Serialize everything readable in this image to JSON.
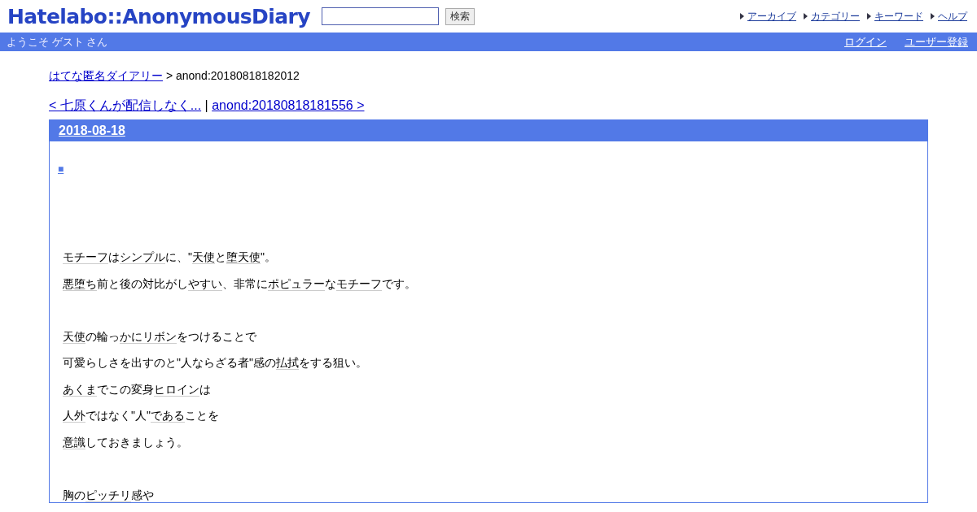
{
  "header": {
    "logo": "Hatelabo::AnonymousDiary",
    "search": {
      "button": "検索"
    },
    "nav": [
      "アーカイブ",
      "カテゴリー",
      "キーワード",
      "ヘルプ"
    ]
  },
  "userbar": {
    "welcome": "ようこそ ゲスト さん",
    "links": [
      "ログイン",
      "ユーザー登録"
    ]
  },
  "breadcrumb": {
    "home": "はてな匿名ダイアリー",
    "separator": ">",
    "current": "anond:20180818182012"
  },
  "pager": {
    "prev": "< 七原くんが配信しなく...",
    "separator": "|",
    "next": "anond:20180818181556 >"
  },
  "day": {
    "date": "2018-08-18",
    "section_mark": "■",
    "lines": [
      {
        "kind": "text",
        "segments": [
          {
            "text": "モチーフ",
            "keyword": true
          },
          {
            "text": "は",
            "keyword": false
          },
          {
            "text": "シンプル",
            "keyword": true
          },
          {
            "text": "に、\"",
            "keyword": false
          },
          {
            "text": "天使",
            "keyword": true
          },
          {
            "text": "と",
            "keyword": false
          },
          {
            "text": "堕天使",
            "keyword": true
          },
          {
            "text": "\"。",
            "keyword": false
          }
        ]
      },
      {
        "kind": "text",
        "segments": [
          {
            "text": "悪堕ち",
            "keyword": true
          },
          {
            "text": "前と後の対比がし",
            "keyword": false
          },
          {
            "text": "やすい",
            "keyword": true
          },
          {
            "text": "、非常に",
            "keyword": false
          },
          {
            "text": "ポピュラー",
            "keyword": true
          },
          {
            "text": "な",
            "keyword": false
          },
          {
            "text": "モチーフ",
            "keyword": true
          },
          {
            "text": "です。",
            "keyword": false
          }
        ]
      },
      {
        "kind": "blank"
      },
      {
        "kind": "text",
        "segments": [
          {
            "text": "天使",
            "keyword": true
          },
          {
            "text": "の輪っ",
            "keyword": false
          },
          {
            "text": "かにリボン",
            "keyword": true
          },
          {
            "text": "をつけることで",
            "keyword": false
          }
        ]
      },
      {
        "kind": "text",
        "segments": [
          {
            "text": "可愛らしさを出すのと\"人ならざる者\"感の",
            "keyword": false
          },
          {
            "text": "払拭",
            "keyword": true
          },
          {
            "text": "をする狙い。",
            "keyword": false
          }
        ]
      },
      {
        "kind": "text",
        "segments": [
          {
            "text": "あくま",
            "keyword": true
          },
          {
            "text": "でこの変身",
            "keyword": false
          },
          {
            "text": "ヒロイン",
            "keyword": true
          },
          {
            "text": "は",
            "keyword": false
          }
        ]
      },
      {
        "kind": "text",
        "segments": [
          {
            "text": "人外",
            "keyword": true
          },
          {
            "text": "ではなく\"人\"",
            "keyword": false
          },
          {
            "text": "である",
            "keyword": true
          },
          {
            "text": "ことを",
            "keyword": false
          }
        ]
      },
      {
        "kind": "text",
        "segments": [
          {
            "text": "意識",
            "keyword": true
          },
          {
            "text": "しておきましょう。",
            "keyword": false
          }
        ]
      },
      {
        "kind": "blank"
      },
      {
        "kind": "text",
        "segments": [
          {
            "text": "胸の",
            "keyword": false
          },
          {
            "text": "ピッチリ",
            "keyword": true
          },
          {
            "text": "感や",
            "keyword": false
          }
        ]
      }
    ]
  }
}
